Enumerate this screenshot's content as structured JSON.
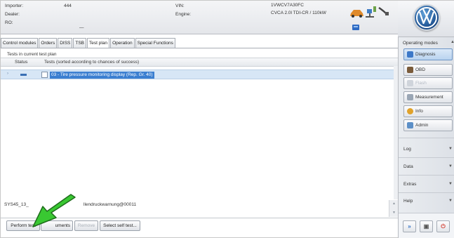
{
  "header": {
    "importer_label": "Importer:",
    "importer_value": "444",
    "dealer_label": "Dealer:",
    "ro_label": "RO:",
    "ro_value": "—",
    "vin_label": "VIN:",
    "vin_value": "1VWCV7A30FC",
    "engine_label": "Engine:",
    "engine_value": "CVCA 2.0l TDI-CR / 110kW"
  },
  "tabs": [
    {
      "label": "Control modules"
    },
    {
      "label": "Orders"
    },
    {
      "label": "DISS"
    },
    {
      "label": "TSB"
    },
    {
      "label": "Test plan",
      "active": true
    },
    {
      "label": "Operation"
    },
    {
      "label": "Special Functions"
    }
  ],
  "test_plan": {
    "title": "Tests in current test plan",
    "col_status": "Status",
    "col_tests": "Tests (sorted according to chances of success)",
    "rows": [
      {
        "text": "03 - Tire pressure monitoring display (Rep. Gr. 40)"
      }
    ]
  },
  "status_line": {
    "prefix": "SYS45_13_",
    "suffix": "llendruckwarnung@00011"
  },
  "buttons": {
    "perform_test": "Perform test",
    "documents": "uments",
    "remove": "Remove",
    "select_self_test": "Select self test..."
  },
  "sidebar": {
    "operating_modes": "Operating modes",
    "modes": [
      {
        "label": "Diagnosis",
        "icon": "diagnosis-icon",
        "active": true
      },
      {
        "label": "OBD",
        "icon": "obd-icon"
      },
      {
        "label": "Flash",
        "icon": "flash-icon",
        "disabled": true
      },
      {
        "label": "Measurement",
        "icon": "measurement-icon"
      },
      {
        "label": "Info",
        "icon": "info-icon"
      },
      {
        "label": "Admin",
        "icon": "admin-icon"
      }
    ],
    "log": "Log",
    "data": "Data",
    "extras": "Extras",
    "help": "Help"
  },
  "colors": {
    "selection": "#3b7fd1",
    "row_highlight": "#d7e6f6",
    "arrow_green": "#39c832"
  }
}
